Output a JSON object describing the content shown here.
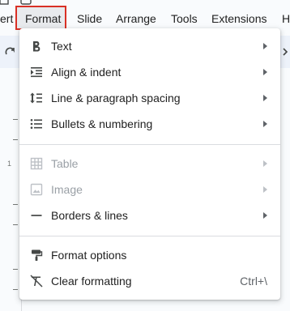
{
  "menubar": {
    "items": [
      {
        "label": "ert"
      },
      {
        "label": "Format"
      },
      {
        "label": "Slide"
      },
      {
        "label": "Arrange"
      },
      {
        "label": "Tools"
      },
      {
        "label": "Extensions"
      },
      {
        "label": "H"
      }
    ]
  },
  "ruler": {
    "number": "1"
  },
  "format_menu": {
    "groups": [
      [
        {
          "label": "Text",
          "icon": "bold-icon",
          "submenu": true
        },
        {
          "label": "Align & indent",
          "icon": "indent-icon",
          "submenu": true
        },
        {
          "label": "Line & paragraph spacing",
          "icon": "line-spacing-icon",
          "submenu": true
        },
        {
          "label": "Bullets & numbering",
          "icon": "bulleted-list-icon",
          "submenu": true
        }
      ],
      [
        {
          "label": "Table",
          "icon": "table-icon",
          "submenu": true,
          "disabled": true
        },
        {
          "label": "Image",
          "icon": "image-icon",
          "submenu": true,
          "disabled": true
        },
        {
          "label": "Borders & lines",
          "icon": "horizontal-line-icon",
          "submenu": true
        }
      ],
      [
        {
          "label": "Format options",
          "icon": "paint-roller-icon"
        },
        {
          "label": "Clear formatting",
          "icon": "clear-format-icon",
          "shortcut": "Ctrl+\\"
        }
      ]
    ]
  },
  "colors": {
    "highlight_border": "#d93025",
    "menu_text": "#1f1f1f",
    "disabled_text": "#9aa0a6"
  }
}
